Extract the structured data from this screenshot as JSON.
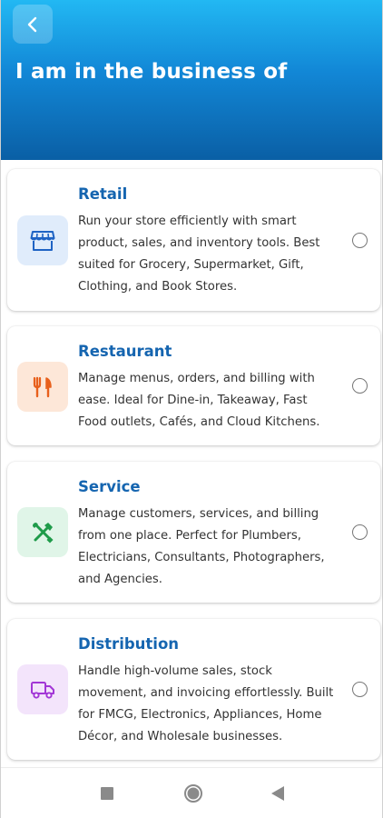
{
  "header": {
    "back_icon": "chevron-left-icon",
    "title": "I am in the business of"
  },
  "options": [
    {
      "title": "Retail",
      "description": "Run your store efficiently with smart product, sales, and inventory tools. Best suited for Grocery, Supermarket, Gift, Clothing, and Book Stores.",
      "icon": "storefront-icon",
      "icon_color": "#1e63c4",
      "icon_bg": "#e0ecfb",
      "selected": false
    },
    {
      "title": "Restaurant",
      "description": "Manage menus, orders, and billing with ease. Ideal for Dine-in, Takeaway, Fast Food outlets, Cafés, and Cloud Kitchens.",
      "icon": "fork-knife-icon",
      "icon_color": "#e8601c",
      "icon_bg": "#fde7d8",
      "selected": false
    },
    {
      "title": "Service",
      "description": "Manage customers, services, and billing from one place. Perfect for Plumbers, Electricians, Consultants, Photographers, and Agencies.",
      "icon": "tools-icon",
      "icon_color": "#1f9b4a",
      "icon_bg": "#e0f5e8",
      "selected": false
    },
    {
      "title": "Distribution",
      "description": "Handle high-volume sales, stock movement, and invoicing effortlessly. Built for FMCG, Electronics, Appliances, Home Décor, and Wholesale businesses.",
      "icon": "truck-icon",
      "icon_color": "#a236d6",
      "icon_bg": "#f3e4fb",
      "selected": false
    }
  ],
  "system_nav": {
    "recents_icon": "square-icon",
    "home_icon": "circle-home-icon",
    "back_icon": "triangle-back-icon"
  },
  "colors": {
    "header_gradient_top": "#22b8f3",
    "header_gradient_bottom": "#0a5fa5",
    "title_accent": "#1565b0"
  }
}
